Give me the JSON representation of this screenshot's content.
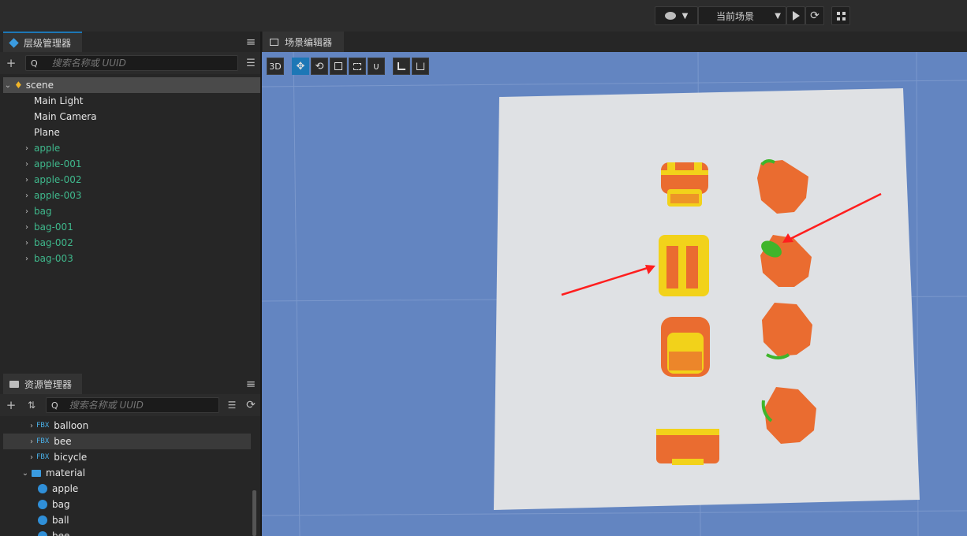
{
  "topbar": {
    "scene_select": "当前场景"
  },
  "hierarchy": {
    "tab_label": "层级管理器",
    "search_placeholder": "搜索名称或 UUID",
    "items": [
      {
        "label": "scene",
        "kind": "root"
      },
      {
        "label": "Main Light",
        "kind": "plain"
      },
      {
        "label": "Main Camera",
        "kind": "plain"
      },
      {
        "label": "Plane",
        "kind": "plain"
      },
      {
        "label": "apple",
        "kind": "prefab"
      },
      {
        "label": "apple-001",
        "kind": "prefab"
      },
      {
        "label": "apple-002",
        "kind": "prefab"
      },
      {
        "label": "apple-003",
        "kind": "prefab"
      },
      {
        "label": "bag",
        "kind": "prefab"
      },
      {
        "label": "bag-001",
        "kind": "prefab"
      },
      {
        "label": "bag-002",
        "kind": "prefab"
      },
      {
        "label": "bag-003",
        "kind": "prefab"
      }
    ]
  },
  "assets": {
    "tab_label": "资源管理器",
    "search_placeholder": "搜索名称或 UUID",
    "fbx_tag": "FBX",
    "fbx_items": [
      "balloon",
      "bee",
      "bicycle"
    ],
    "folder": "material",
    "materials": [
      "apple",
      "bag",
      "ball",
      "bee"
    ]
  },
  "scene_editor": {
    "tab_label": "场景编辑器",
    "mode_3d": "3D"
  },
  "colors": {
    "viewport_bg": "#6385c1",
    "plane": "#dfe1e4",
    "orange": "#ea6c30",
    "yellow": "#f2d21a",
    "leaf": "#3fb52b",
    "arrow": "#ff1e1e",
    "accent": "#1d77b6"
  }
}
